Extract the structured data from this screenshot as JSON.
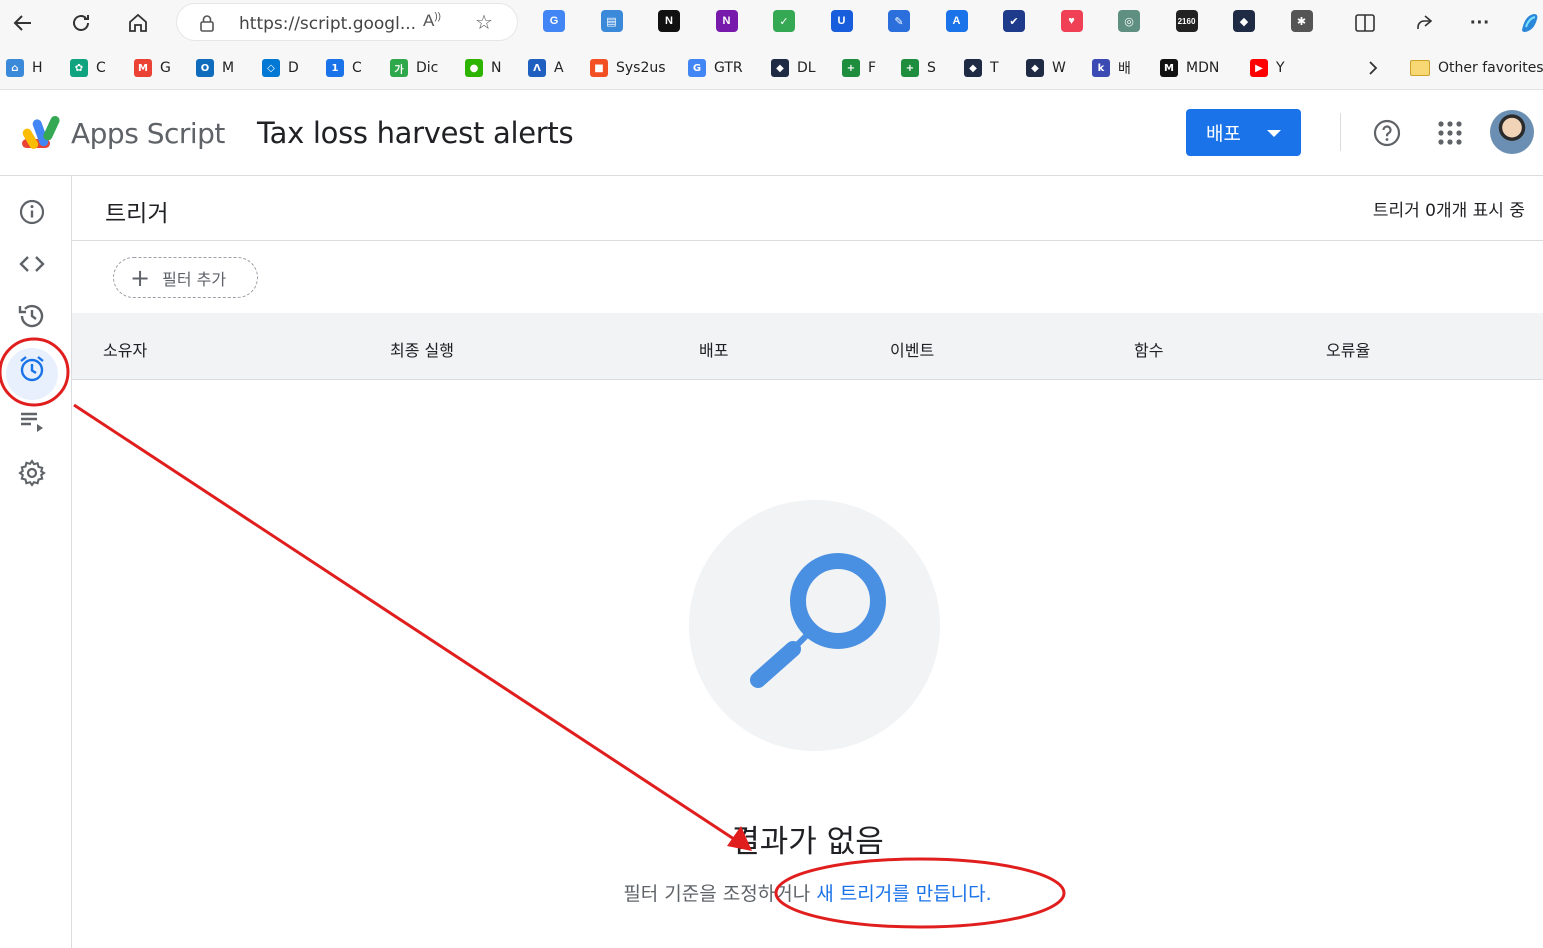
{
  "browser": {
    "url": "https://script.googl...",
    "extensions": [
      {
        "name": "google-translate-ext",
        "color": "#4285f4",
        "glyph": "G"
      },
      {
        "name": "reader-ext",
        "color": "#3b8ad9",
        "glyph": "▤"
      },
      {
        "name": "notion-ext",
        "color": "#111111",
        "glyph": "N"
      },
      {
        "name": "onenote-ext",
        "color": "#7719aa",
        "glyph": "N"
      },
      {
        "name": "shield-ext",
        "color": "#34a853",
        "glyph": "✓"
      },
      {
        "name": "bitwarden-ext",
        "color": "#175ddc",
        "glyph": "U"
      },
      {
        "name": "pen-ext",
        "color": "#2a6fdb",
        "glyph": "✎"
      },
      {
        "name": "font-ext",
        "color": "#1a73e8",
        "glyph": "A"
      },
      {
        "name": "check-ext",
        "color": "#1e3a8a",
        "glyph": "✔"
      },
      {
        "name": "pocket-ext",
        "color": "#ef4056",
        "glyph": "♥"
      },
      {
        "name": "ai-ext",
        "color": "#5f8f80",
        "glyph": "◎"
      },
      {
        "name": "counter-ext",
        "color": "#222222",
        "glyph": "2160"
      },
      {
        "name": "cube-ext",
        "color": "#1f2a44",
        "glyph": "◆"
      },
      {
        "name": "puzzle-ext",
        "color": "#555555",
        "glyph": "✱"
      }
    ]
  },
  "bookmarks": [
    {
      "label": "H",
      "color": "#3b8ad9",
      "glyph": "⌂"
    },
    {
      "label": "C",
      "color": "#10a37f",
      "glyph": "✿"
    },
    {
      "label": "G",
      "color": "#ea4335",
      "glyph": "M"
    },
    {
      "label": "M",
      "color": "#0f6cbd",
      "glyph": "O"
    },
    {
      "label": "D",
      "color": "#0078d4",
      "glyph": "◇"
    },
    {
      "label": "C",
      "color": "#1a73e8",
      "glyph": "1"
    },
    {
      "label": "Dic",
      "color": "#2ea84a",
      "glyph": "가"
    },
    {
      "label": "N",
      "color": "#2db400",
      "glyph": "●"
    },
    {
      "label": "A",
      "color": "#1f5fbf",
      "glyph": "Λ"
    },
    {
      "label": "Sys2us",
      "color": "#f25022",
      "glyph": "■"
    },
    {
      "label": "GTR",
      "color": "#4285f4",
      "glyph": "G"
    },
    {
      "label": "DL",
      "color": "#1f2a44",
      "glyph": "◆"
    },
    {
      "label": "F",
      "color": "#1e8e3e",
      "glyph": "+"
    },
    {
      "label": "S",
      "color": "#1e8e3e",
      "glyph": "+"
    },
    {
      "label": "T",
      "color": "#1f2a44",
      "glyph": "◆"
    },
    {
      "label": "W",
      "color": "#1f2a44",
      "glyph": "◆"
    },
    {
      "label": "배",
      "color": "#3b4bb3",
      "glyph": "k"
    },
    {
      "label": "MDN",
      "color": "#111111",
      "glyph": "M"
    },
    {
      "label": "Y",
      "color": "#ff0000",
      "glyph": "▶"
    }
  ],
  "bookmarks_overflow": "Other favorites",
  "header": {
    "app_name": "Apps Script",
    "project_title": "Tax loss harvest alerts",
    "deploy_label": "배포"
  },
  "rail": {
    "items": [
      "overview",
      "editor",
      "executions-history",
      "triggers",
      "executions",
      "project-settings"
    ],
    "active": "triggers"
  },
  "page": {
    "title": "트리거",
    "showing_count": "트리거 0개개 표시 중",
    "add_filter_label": "필터 추가"
  },
  "table": {
    "columns": [
      "소유자",
      "최종 실행",
      "배포",
      "이벤트",
      "함수",
      "오류율"
    ]
  },
  "empty_state": {
    "title": "결과가 없음",
    "message_prefix": "필터 기준을 조정하거나 ",
    "link_text": "새 트리거를 만듭니다."
  },
  "colors": {
    "accent": "#1a73e8",
    "annotation": "#e01e1e"
  }
}
